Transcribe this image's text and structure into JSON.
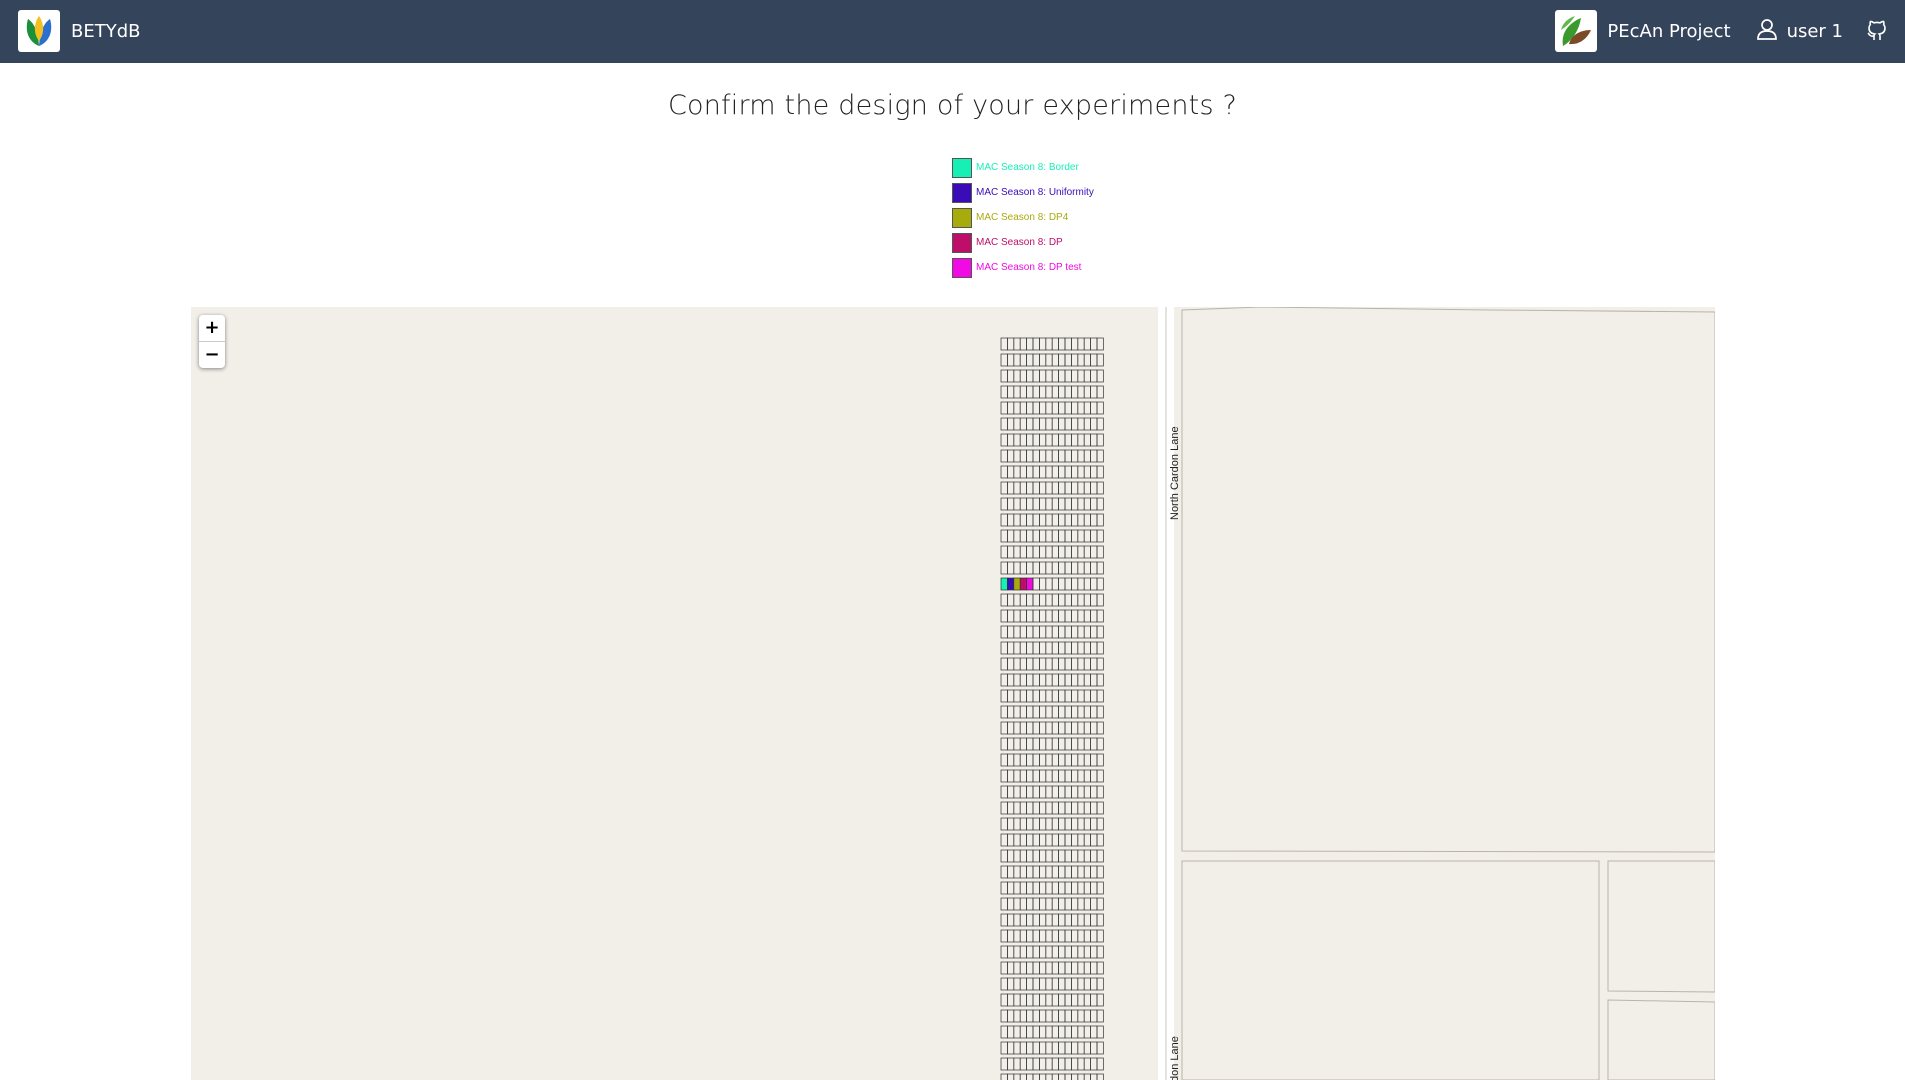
{
  "navbar": {
    "brand_label": "BETYdB",
    "project_label": "PEcAn Project",
    "user_label": "user 1",
    "brand_icon": "betydb-leaf-logo",
    "project_icon": "pecan-leaf-logo",
    "user_icon": "user-icon",
    "github_icon": "github-icon",
    "background_color": "#34445b"
  },
  "page": {
    "title": "Confirm the design of your experiments ?"
  },
  "legend": [
    {
      "label": "MAC Season 8: Border",
      "color": "#16f0b4"
    },
    {
      "label": "MAC Season 8: Uniformity",
      "color": "#3a0cb8"
    },
    {
      "label": "MAC Season 8: DP4",
      "color": "#a8ab0c"
    },
    {
      "label": "MAC Season 8: DP",
      "color": "#bd0e6a"
    },
    {
      "label": "MAC Season 8: DP test",
      "color": "#f20ae4"
    }
  ],
  "map": {
    "zoom_in_label": "+",
    "zoom_out_label": "−",
    "street_label_upper": "North Cardon Lane",
    "street_label_lower": "don Lane",
    "background_color": "#f2efe9"
  }
}
